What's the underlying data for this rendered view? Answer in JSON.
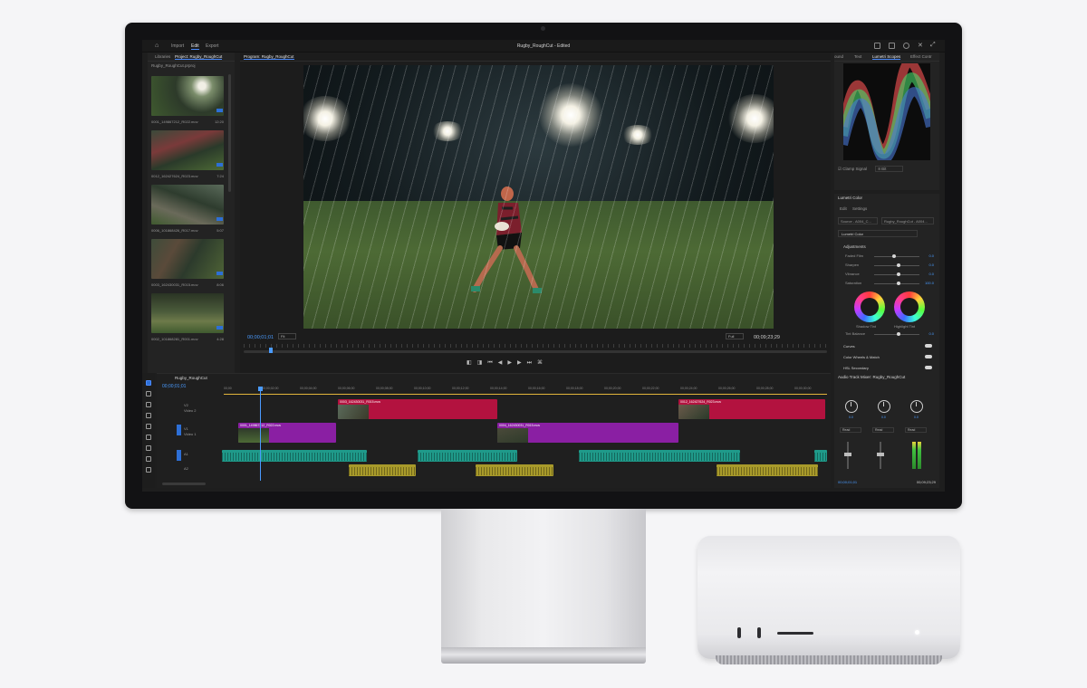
{
  "topbar": {
    "nav": [
      "Import",
      "Edit",
      "Export"
    ],
    "title": "Rugby_RoughCut - Edited"
  },
  "project": {
    "tabs": [
      "Libraries",
      "Project: Rugby_RoughCut"
    ],
    "path": "Rugby_RoughCut.prproj",
    "clips": [
      {
        "name": "0001_149867212_R022.mov",
        "duration": "12:20"
      },
      {
        "name": "0012_162427624_R023.mov",
        "duration": "7:24"
      },
      {
        "name": "0006_101868426_R017.mov",
        "duration": "5:07"
      },
      {
        "name": "0003_162430031_R015.mov",
        "duration": "8:06"
      },
      {
        "name": "0002_101868281_R001.mov",
        "duration": "4:28"
      }
    ]
  },
  "program": {
    "tab": "Program: Rugby_RoughCut",
    "timecode_left": "00;00;01;01",
    "timecode_right": "00;09;23;29",
    "fit": "Fit",
    "quality": "Full"
  },
  "scopes": {
    "tabs": [
      "ound",
      "Text",
      "Lumetri Scopes",
      "Effect Contr"
    ],
    "clamp_label": "Clamp Signal",
    "bit_label": "8 Bit"
  },
  "lumetri": {
    "title": "Lumetri Color",
    "subtabs": [
      "Edit",
      "Settings"
    ],
    "source": "Source - A004_C...",
    "target": "Rugby_RoughCut - A004...",
    "preset": "Lumetri Color",
    "section": "Adjustments",
    "sliders": [
      {
        "label": "Faded Film",
        "value": "0.0",
        "pos": 0.4
      },
      {
        "label": "Sharpen",
        "value": "0.0",
        "pos": 0.5
      },
      {
        "label": "Vibrance",
        "value": "0.0",
        "pos": 0.5
      },
      {
        "label": "Saturation",
        "value": "100.0",
        "pos": 0.5
      }
    ],
    "wheels": [
      "Shadow Tint",
      "Highlight Tint"
    ],
    "tint_balance": "Tint Balance",
    "tint_value": "0.0",
    "sections": [
      "Curves",
      "Color Wheels & Match",
      "HSL Secondary",
      "Vignette"
    ]
  },
  "timeline": {
    "tab": "Rugby_RoughCut",
    "timecode": "00;00;01;01",
    "ruler": [
      "00;00",
      "00;00;02;00",
      "00;00;04;00",
      "00;00;06;00",
      "00;00;08;00",
      "00;00;10;00",
      "00;00;12;00",
      "00;00;14;00",
      "00;00;16;00",
      "00;00;18;00",
      "00;00;20;00",
      "00;00;22;00",
      "00;00;24;00",
      "00;00;26;00",
      "00;00;28;00",
      "00;00;30;00"
    ],
    "tracks": [
      "V2",
      "V1",
      "A1",
      "A2"
    ],
    "track_names": [
      "Video 2",
      "Video 1"
    ],
    "clips_v2": [
      "0003_162430031_R015.mov",
      "0012_162427624_R023.mov"
    ],
    "clips_v1": [
      "0001_149867212_R022.mov",
      "0004_162430031_R015.mov"
    ]
  },
  "mixer": {
    "title": "Audio Track Mixer: Rugby_RoughCut",
    "knob_values": [
      "0.0",
      "0.0",
      "0.0"
    ],
    "mode": [
      "Read",
      "Read",
      "Read"
    ],
    "timecode_left": "00;00;01;01",
    "timecode_right": "00;09;23;29"
  },
  "colors": {
    "accent": "#4a8bff",
    "clip_red": "#b3123f",
    "clip_purple": "#8a1fa3",
    "clip_teal": "#1f9a8a",
    "clip_yellow": "#a89a2a"
  }
}
